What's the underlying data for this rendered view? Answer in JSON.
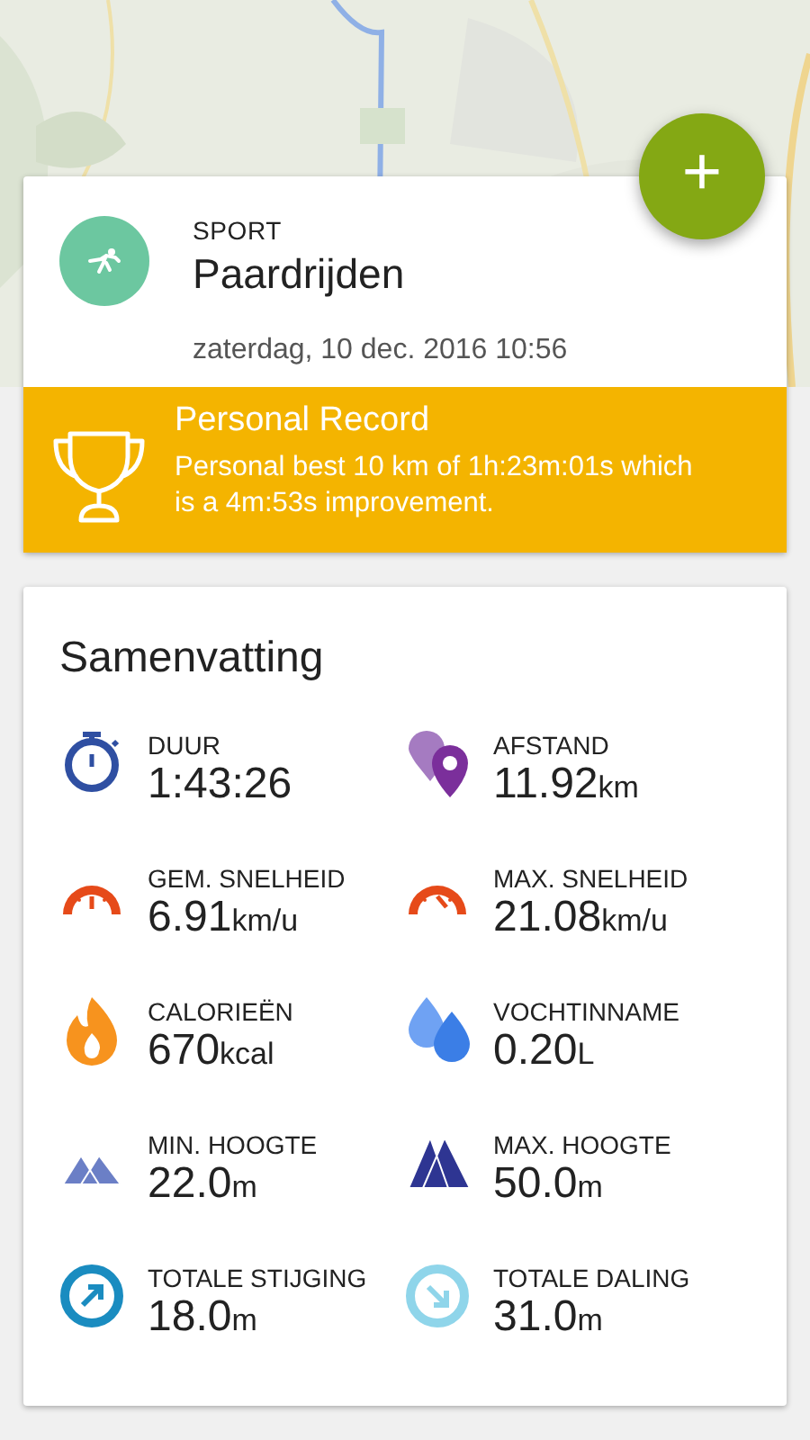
{
  "add_button": {
    "label": "+"
  },
  "activity": {
    "caption": "SPORT",
    "sport": "Paardrijden",
    "date": "zaterdag, 10 dec. 2016 10:56"
  },
  "record": {
    "title": "Personal Record",
    "text": "Personal best 10 km of 1h:23m:01s which is a 4m:53s improvement."
  },
  "summary": {
    "title": "Samenvatting",
    "stats": [
      {
        "kind": "duration",
        "label": "DUUR",
        "value": "1:43:26"
      },
      {
        "kind": "distance",
        "label": "AFSTAND",
        "value": "11.92",
        "unit": "km"
      },
      {
        "kind": "avg-speed",
        "label": "GEM. SNELHEID",
        "value": "6.91",
        "unit": "km/u"
      },
      {
        "kind": "max-speed",
        "label": "MAX. SNELHEID",
        "value": "21.08",
        "unit": "km/u"
      },
      {
        "kind": "calories",
        "label": "CALORIEËN",
        "value": "670",
        "unit": "kcal"
      },
      {
        "kind": "water",
        "label": "VOCHTINNAME",
        "value": "0.20",
        "unit": "L"
      },
      {
        "kind": "min-altitude",
        "label": "MIN. HOOGTE",
        "value": "22.0",
        "unit": "m"
      },
      {
        "kind": "max-altitude",
        "label": "MAX. HOOGTE",
        "value": "50.0",
        "unit": "m"
      },
      {
        "kind": "ascent",
        "label": "TOTALE STIJGING",
        "value": "18.0",
        "unit": "m"
      },
      {
        "kind": "descent",
        "label": "TOTALE DALING",
        "value": "31.0",
        "unit": "m"
      }
    ]
  }
}
